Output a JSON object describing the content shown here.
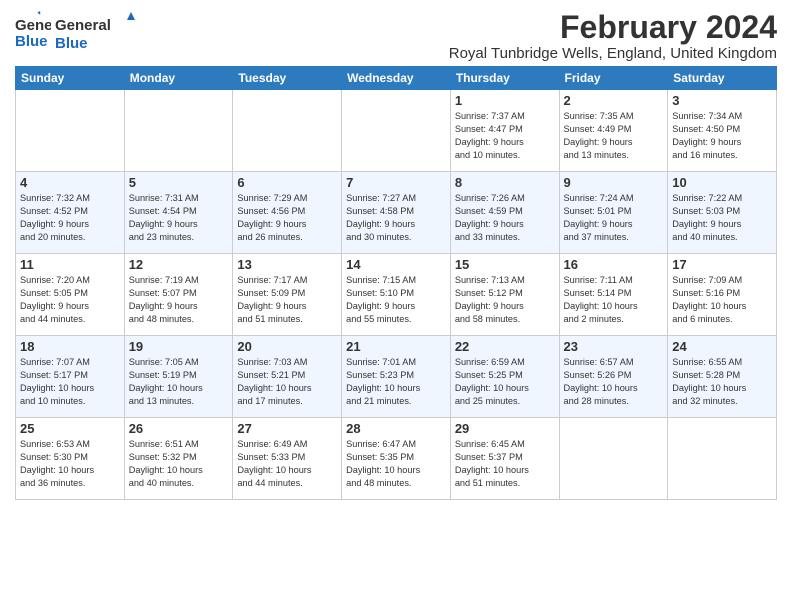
{
  "header": {
    "logo_general": "General",
    "logo_blue": "Blue",
    "month_title": "February 2024",
    "location": "Royal Tunbridge Wells, England, United Kingdom"
  },
  "columns": [
    "Sunday",
    "Monday",
    "Tuesday",
    "Wednesday",
    "Thursday",
    "Friday",
    "Saturday"
  ],
  "weeks": [
    [
      {
        "day": "",
        "info": ""
      },
      {
        "day": "",
        "info": ""
      },
      {
        "day": "",
        "info": ""
      },
      {
        "day": "",
        "info": ""
      },
      {
        "day": "1",
        "info": "Sunrise: 7:37 AM\nSunset: 4:47 PM\nDaylight: 9 hours\nand 10 minutes."
      },
      {
        "day": "2",
        "info": "Sunrise: 7:35 AM\nSunset: 4:49 PM\nDaylight: 9 hours\nand 13 minutes."
      },
      {
        "day": "3",
        "info": "Sunrise: 7:34 AM\nSunset: 4:50 PM\nDaylight: 9 hours\nand 16 minutes."
      }
    ],
    [
      {
        "day": "4",
        "info": "Sunrise: 7:32 AM\nSunset: 4:52 PM\nDaylight: 9 hours\nand 20 minutes."
      },
      {
        "day": "5",
        "info": "Sunrise: 7:31 AM\nSunset: 4:54 PM\nDaylight: 9 hours\nand 23 minutes."
      },
      {
        "day": "6",
        "info": "Sunrise: 7:29 AM\nSunset: 4:56 PM\nDaylight: 9 hours\nand 26 minutes."
      },
      {
        "day": "7",
        "info": "Sunrise: 7:27 AM\nSunset: 4:58 PM\nDaylight: 9 hours\nand 30 minutes."
      },
      {
        "day": "8",
        "info": "Sunrise: 7:26 AM\nSunset: 4:59 PM\nDaylight: 9 hours\nand 33 minutes."
      },
      {
        "day": "9",
        "info": "Sunrise: 7:24 AM\nSunset: 5:01 PM\nDaylight: 9 hours\nand 37 minutes."
      },
      {
        "day": "10",
        "info": "Sunrise: 7:22 AM\nSunset: 5:03 PM\nDaylight: 9 hours\nand 40 minutes."
      }
    ],
    [
      {
        "day": "11",
        "info": "Sunrise: 7:20 AM\nSunset: 5:05 PM\nDaylight: 9 hours\nand 44 minutes."
      },
      {
        "day": "12",
        "info": "Sunrise: 7:19 AM\nSunset: 5:07 PM\nDaylight: 9 hours\nand 48 minutes."
      },
      {
        "day": "13",
        "info": "Sunrise: 7:17 AM\nSunset: 5:09 PM\nDaylight: 9 hours\nand 51 minutes."
      },
      {
        "day": "14",
        "info": "Sunrise: 7:15 AM\nSunset: 5:10 PM\nDaylight: 9 hours\nand 55 minutes."
      },
      {
        "day": "15",
        "info": "Sunrise: 7:13 AM\nSunset: 5:12 PM\nDaylight: 9 hours\nand 58 minutes."
      },
      {
        "day": "16",
        "info": "Sunrise: 7:11 AM\nSunset: 5:14 PM\nDaylight: 10 hours\nand 2 minutes."
      },
      {
        "day": "17",
        "info": "Sunrise: 7:09 AM\nSunset: 5:16 PM\nDaylight: 10 hours\nand 6 minutes."
      }
    ],
    [
      {
        "day": "18",
        "info": "Sunrise: 7:07 AM\nSunset: 5:17 PM\nDaylight: 10 hours\nand 10 minutes."
      },
      {
        "day": "19",
        "info": "Sunrise: 7:05 AM\nSunset: 5:19 PM\nDaylight: 10 hours\nand 13 minutes."
      },
      {
        "day": "20",
        "info": "Sunrise: 7:03 AM\nSunset: 5:21 PM\nDaylight: 10 hours\nand 17 minutes."
      },
      {
        "day": "21",
        "info": "Sunrise: 7:01 AM\nSunset: 5:23 PM\nDaylight: 10 hours\nand 21 minutes."
      },
      {
        "day": "22",
        "info": "Sunrise: 6:59 AM\nSunset: 5:25 PM\nDaylight: 10 hours\nand 25 minutes."
      },
      {
        "day": "23",
        "info": "Sunrise: 6:57 AM\nSunset: 5:26 PM\nDaylight: 10 hours\nand 28 minutes."
      },
      {
        "day": "24",
        "info": "Sunrise: 6:55 AM\nSunset: 5:28 PM\nDaylight: 10 hours\nand 32 minutes."
      }
    ],
    [
      {
        "day": "25",
        "info": "Sunrise: 6:53 AM\nSunset: 5:30 PM\nDaylight: 10 hours\nand 36 minutes."
      },
      {
        "day": "26",
        "info": "Sunrise: 6:51 AM\nSunset: 5:32 PM\nDaylight: 10 hours\nand 40 minutes."
      },
      {
        "day": "27",
        "info": "Sunrise: 6:49 AM\nSunset: 5:33 PM\nDaylight: 10 hours\nand 44 minutes."
      },
      {
        "day": "28",
        "info": "Sunrise: 6:47 AM\nSunset: 5:35 PM\nDaylight: 10 hours\nand 48 minutes."
      },
      {
        "day": "29",
        "info": "Sunrise: 6:45 AM\nSunset: 5:37 PM\nDaylight: 10 hours\nand 51 minutes."
      },
      {
        "day": "",
        "info": ""
      },
      {
        "day": "",
        "info": ""
      }
    ]
  ]
}
